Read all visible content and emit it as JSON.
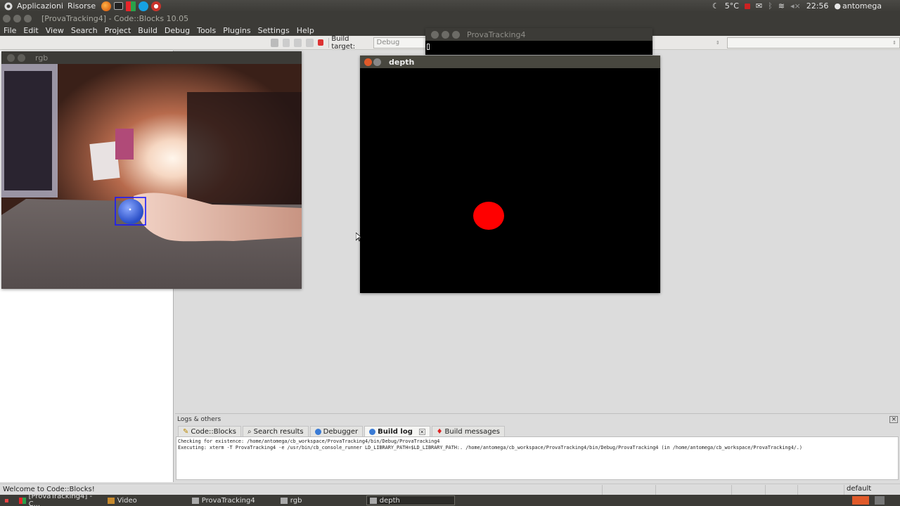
{
  "top_panel": {
    "apps_menu": "Applicazioni",
    "places_menu": "Risorse",
    "weather": "5°C",
    "clock": "22:56",
    "user": "antomega"
  },
  "codeblocks": {
    "window_title": "[ProvaTracking4] - Code::Blocks 10.05",
    "menu": [
      "File",
      "Edit",
      "View",
      "Search",
      "Project",
      "Build",
      "Debug",
      "Tools",
      "Plugins",
      "Settings",
      "Help"
    ],
    "build_target_label": "Build target:",
    "build_target_value": "Debug",
    "logs_title": "Logs & others",
    "tabs": [
      "Code::Blocks",
      "Search results",
      "Debugger",
      "Build log",
      "Build messages"
    ],
    "active_tab": "Build log",
    "log_lines": [
      "Checking for existence: /home/antomega/cb_workspace/ProvaTracking4/bin/Debug/ProvaTracking4",
      "Executing: xterm -T ProvaTracking4 -e /usr/bin/cb_console_runner LD_LIBRARY_PATH=$LD_LIBRARY_PATH:. /home/antomega/cb_workspace/ProvaTracking4/bin/Debug/ProvaTracking4  (in /home/antomega/cb_workspace/ProvaTracking4/.)"
    ],
    "status_message": "Welcome to Code::Blocks!",
    "status_right": "default"
  },
  "windows": {
    "rgb_title": "rgb",
    "depth_title": "depth",
    "console_title": "ProvaTracking4"
  },
  "taskbar": {
    "items": [
      "[ProvaTracking4] - C...",
      "Video",
      "ProvaTracking4",
      "rgb",
      "depth"
    ],
    "active": "depth"
  },
  "colors": {
    "tracked_blob": "#ff0000",
    "bounding_box": "#1a1aff"
  }
}
